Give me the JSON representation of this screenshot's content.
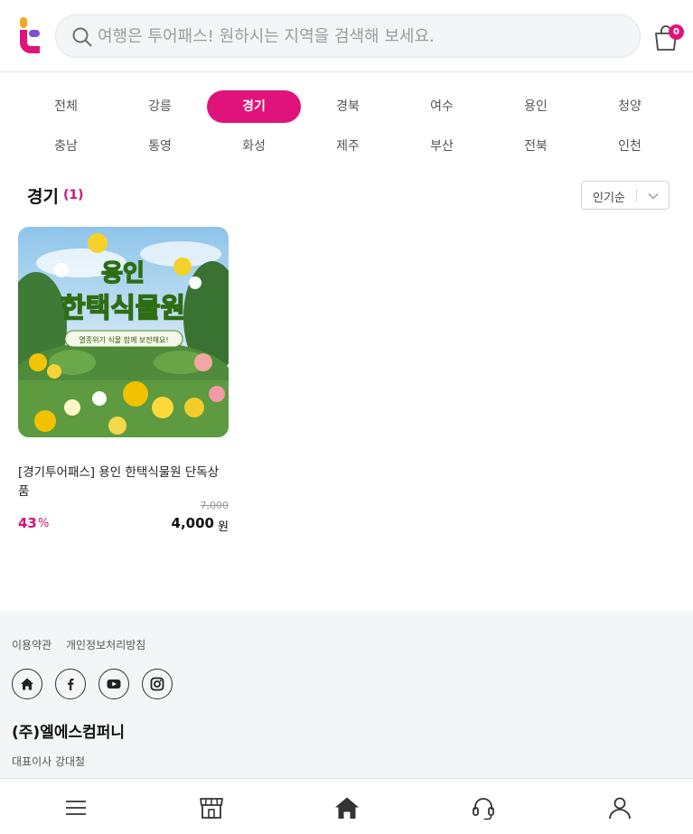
{
  "header": {
    "search_placeholder": "여행은 투어패스! 원하시는 지역을 검색해 보세요.",
    "cart_count": "0"
  },
  "regions": {
    "row1": [
      "전체",
      "강릉",
      "경기",
      "경북",
      "여수",
      "용인",
      "청양"
    ],
    "row2": [
      "충남",
      "통영",
      "화성",
      "제주",
      "부산",
      "전북",
      "인천"
    ],
    "active": "경기"
  },
  "section": {
    "title": "경기",
    "count": "(1)",
    "sort_label": "인기순"
  },
  "product": {
    "image_headline_1": "용인",
    "image_headline_2": "한택식물원",
    "image_caption": "멸종위기 식물 함께 보전해요!",
    "title": "[경기투어패스] 용인 한택식물원 단독상품",
    "original_price": "7,000",
    "discount": "43",
    "discount_unit": "%",
    "price": "4,000",
    "price_unit": "원"
  },
  "footer": {
    "links": [
      "이용약관",
      "개인정보처리방침"
    ],
    "socials": [
      "home-icon",
      "facebook-icon",
      "youtube-icon",
      "instagram-icon"
    ],
    "company": "(주)엘에스컴퍼니",
    "ceo": "대표이사 강대철"
  },
  "bottom_nav": [
    "menu-icon",
    "store-icon",
    "home-icon",
    "support-headset-icon",
    "user-icon"
  ],
  "colors": {
    "accent": "#e0137a",
    "footer_bg": "#f4f5f7"
  }
}
